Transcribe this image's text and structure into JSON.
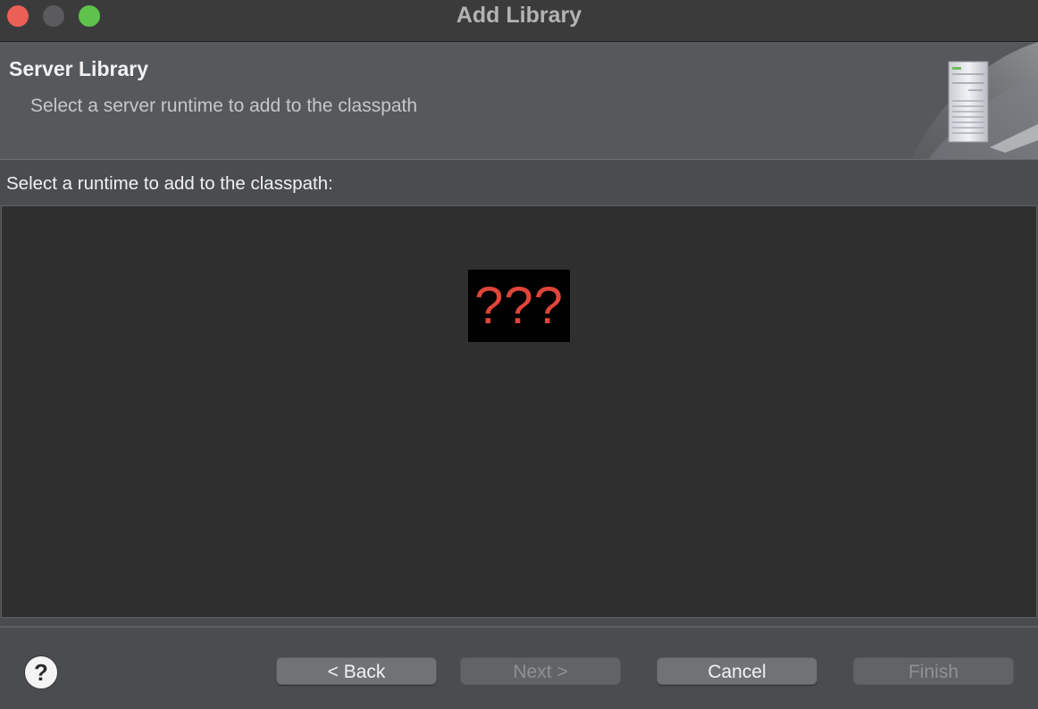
{
  "window": {
    "title": "Add Library"
  },
  "banner": {
    "title": "Server Library",
    "description": "Select a server runtime to add to the classpath",
    "image_icon": "server-tower-icon"
  },
  "main": {
    "prompt": "Select a runtime to add to the classpath:",
    "missing_image_text": "???"
  },
  "footer": {
    "help_icon": "?",
    "buttons": {
      "back": "< Back",
      "next": "Next >",
      "cancel": "Cancel",
      "finish": "Finish"
    }
  },
  "colors": {
    "close": "#ec5f57",
    "minimize": "#5b5b5e",
    "zoom": "#5fc24d",
    "missing_text": "#e0453a"
  }
}
